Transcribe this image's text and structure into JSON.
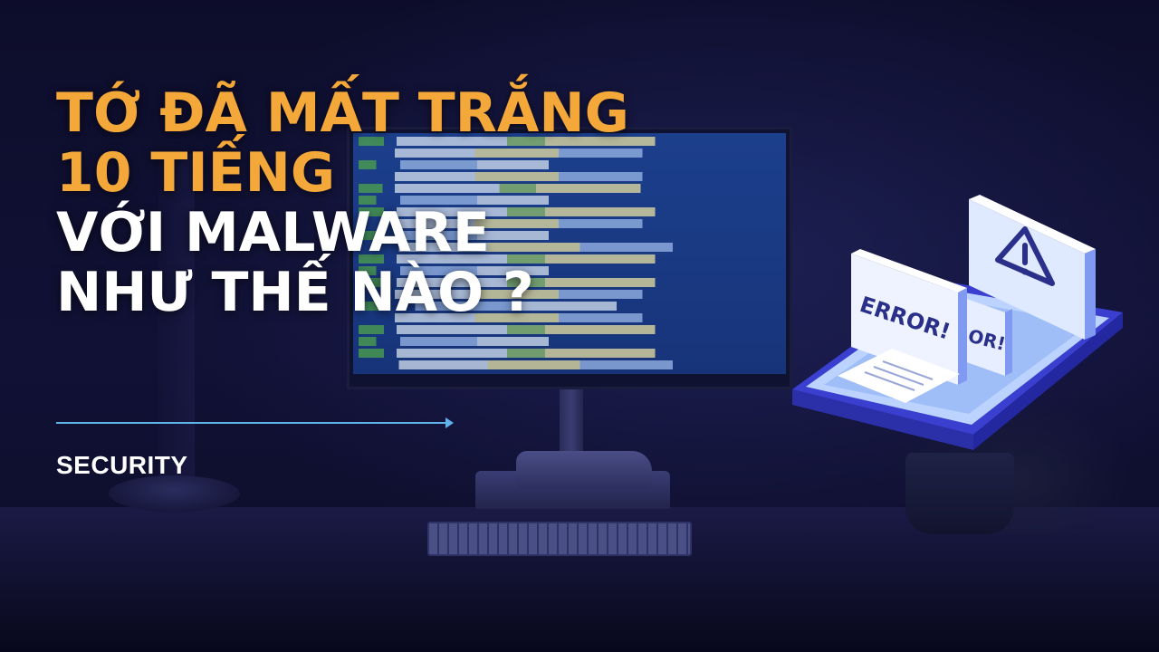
{
  "title_lines": [
    {
      "text": "TỚ ĐÃ MẤT TRẮNG",
      "color": "#f4a83a"
    },
    {
      "text": "10 TIẾNG",
      "color": "#f4a83a"
    },
    {
      "text": "VỚI MALWARE",
      "color": "#ffffff"
    },
    {
      "text": "NHƯ THẾ NÀO ?",
      "color": "#ffffff"
    }
  ],
  "category": "SECURITY",
  "illustration": {
    "error_label": "ERROR!",
    "error_label_partial": "OR!",
    "icon": "warning-triangle-icon"
  },
  "colors": {
    "accent_orange": "#f4a83a",
    "accent_blue": "#5fb3e8",
    "background": "#0a0a22"
  }
}
